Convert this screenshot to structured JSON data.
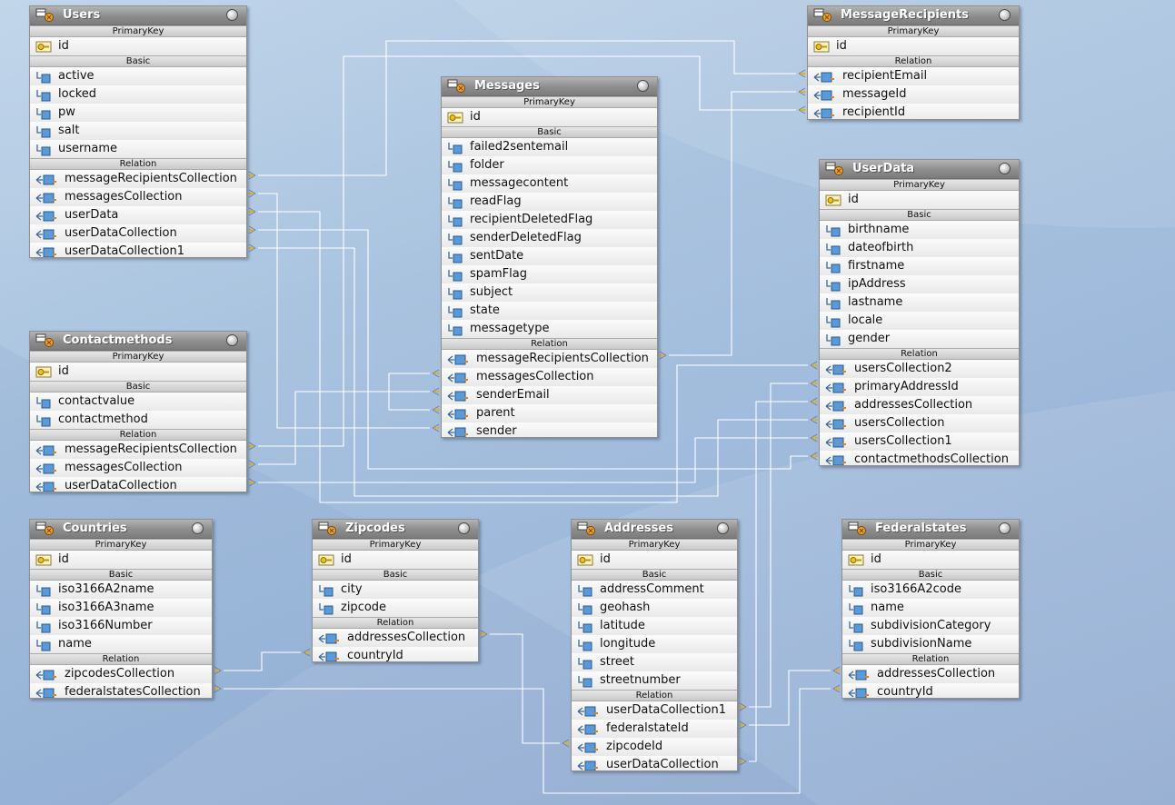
{
  "section_labels": {
    "primary": "PrimaryKey",
    "basic": "Basic",
    "relation": "Relation"
  },
  "entities": {
    "users": {
      "title": "Users",
      "pk": [
        "id"
      ],
      "basic": [
        "active",
        "locked",
        "pw",
        "salt",
        "username"
      ],
      "relation": [
        "messageRecipientsCollection",
        "messagesCollection",
        "userData",
        "userDataCollection",
        "userDataCollection1"
      ]
    },
    "messages": {
      "title": "Messages",
      "pk": [
        "id"
      ],
      "basic": [
        "failed2sentemail",
        "folder",
        "messagecontent",
        "readFlag",
        "recipientDeletedFlag",
        "senderDeletedFlag",
        "sentDate",
        "spamFlag",
        "subject",
        "state",
        "messagetype"
      ],
      "relation": [
        "messageRecipientsCollection",
        "messagesCollection",
        "senderEmail",
        "parent",
        "sender"
      ]
    },
    "messagerecipients": {
      "title": "MessageRecipients",
      "pk": [
        "id"
      ],
      "basic": [],
      "relation": [
        "recipientEmail",
        "messageId",
        "recipientId"
      ]
    },
    "userdata": {
      "title": "UserData",
      "pk": [
        "id"
      ],
      "basic": [
        "birthname",
        "dateofbirth",
        "firstname",
        "ipAddress",
        "lastname",
        "locale",
        "gender"
      ],
      "relation": [
        "usersCollection2",
        "primaryAddressId",
        "addressesCollection",
        "usersCollection",
        "usersCollection1",
        "contactmethodsCollection"
      ]
    },
    "contactmethods": {
      "title": "Contactmethods",
      "pk": [
        "id"
      ],
      "basic": [
        "contactvalue",
        "contactmethod"
      ],
      "relation": [
        "messageRecipientsCollection",
        "messagesCollection",
        "userDataCollection"
      ]
    },
    "countries": {
      "title": "Countries",
      "pk": [
        "id"
      ],
      "basic": [
        "iso3166A2name",
        "iso3166A3name",
        "iso3166Number",
        "name"
      ],
      "relation": [
        "zipcodesCollection",
        "federalstatesCollection"
      ]
    },
    "zipcodes": {
      "title": "Zipcodes",
      "pk": [
        "id"
      ],
      "basic": [
        "city",
        "zipcode"
      ],
      "relation": [
        "addressesCollection",
        "countryId"
      ]
    },
    "addresses": {
      "title": "Addresses",
      "pk": [
        "id"
      ],
      "basic": [
        "addressComment",
        "geohash",
        "latitude",
        "longitude",
        "street",
        "streetnumber"
      ],
      "relation": [
        "userDataCollection1",
        "federalstateId",
        "zipcodeId",
        "userDataCollection"
      ]
    },
    "federalstates": {
      "title": "Federalstates",
      "pk": [
        "id"
      ],
      "basic": [
        "iso3166A2code",
        "name",
        "subdivisionCategory",
        "subdivisionName"
      ],
      "relation": [
        "addressesCollection",
        "countryId"
      ]
    }
  }
}
